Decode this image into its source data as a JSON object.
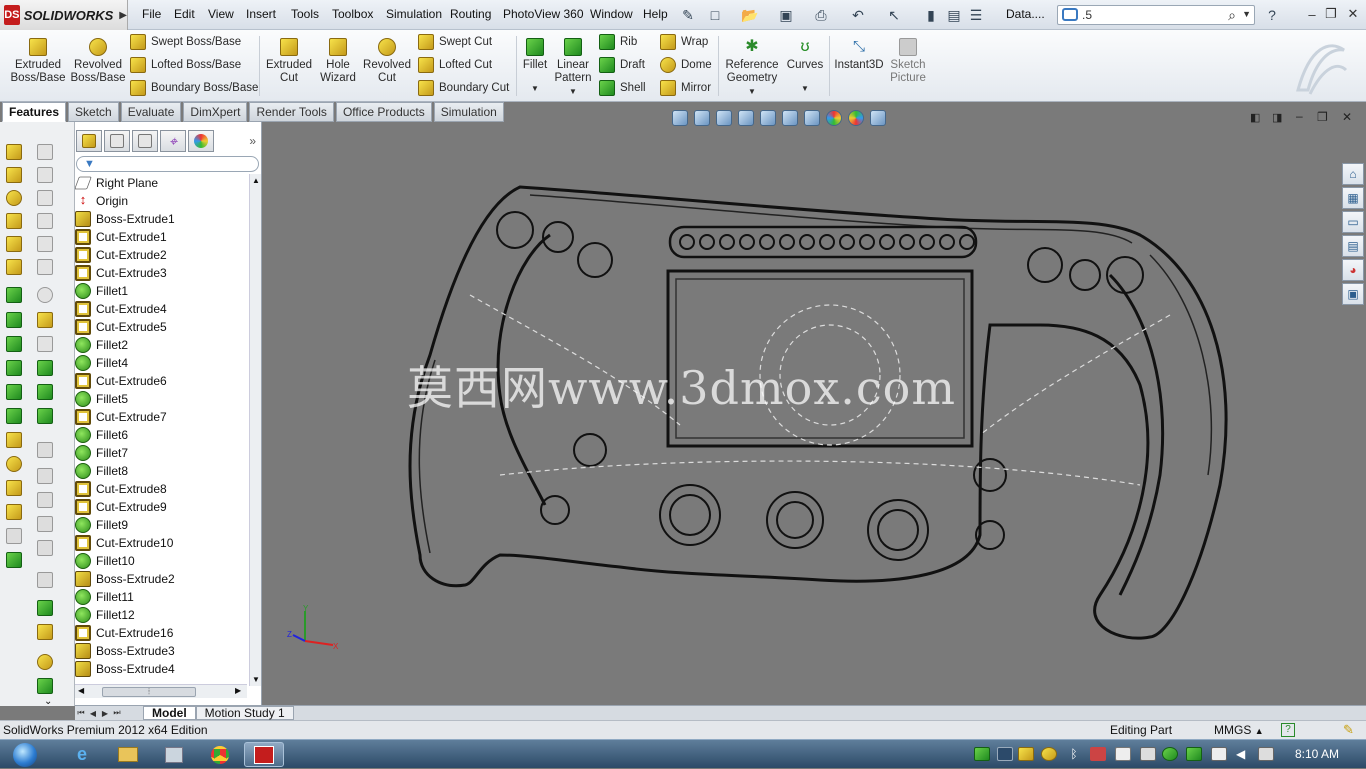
{
  "app": {
    "brand": "SOLIDWORKS",
    "brand_mark": "DS"
  },
  "menu": [
    "File",
    "Edit",
    "View",
    "Insert",
    "Tools",
    "Toolbox",
    "Simulation",
    "Routing",
    "PhotoView 360",
    "Window",
    "Help"
  ],
  "title_doc": "Data....",
  "search": {
    "value": ".5"
  },
  "ribbon": {
    "extruded_boss": "Extruded\nBoss/Base",
    "revolved_boss": "Revolved\nBoss/Base",
    "swept_boss": "Swept Boss/Base",
    "lofted_boss": "Lofted Boss/Base",
    "boundary_boss": "Boundary Boss/Base",
    "extruded_cut": "Extruded\nCut",
    "hole_wizard": "Hole\nWizard",
    "revolved_cut": "Revolved\nCut",
    "swept_cut": "Swept Cut",
    "lofted_cut": "Lofted Cut",
    "boundary_cut": "Boundary Cut",
    "fillet": "Fillet",
    "linear_pattern": "Linear\nPattern",
    "rib": "Rib",
    "draft": "Draft",
    "shell": "Shell",
    "wrap": "Wrap",
    "dome": "Dome",
    "mirror": "Mirror",
    "reference_geometry": "Reference\nGeometry",
    "curves": "Curves",
    "instant3d": "Instant3D",
    "sketch_picture": "Sketch\nPicture"
  },
  "command_tabs": [
    "Features",
    "Sketch",
    "Evaluate",
    "DimXpert",
    "Render Tools",
    "Office Products",
    "Simulation"
  ],
  "feature_tree": [
    {
      "label": "Right Plane",
      "icon": "plane"
    },
    {
      "label": "Origin",
      "icon": "origin"
    },
    {
      "label": "Boss-Extrude1",
      "icon": "ext"
    },
    {
      "label": "Cut-Extrude1",
      "icon": "cut"
    },
    {
      "label": "Cut-Extrude2",
      "icon": "cut"
    },
    {
      "label": "Cut-Extrude3",
      "icon": "cut"
    },
    {
      "label": "Fillet1",
      "icon": "fil"
    },
    {
      "label": "Cut-Extrude4",
      "icon": "cut"
    },
    {
      "label": "Cut-Extrude5",
      "icon": "cut"
    },
    {
      "label": "Fillet2",
      "icon": "fil"
    },
    {
      "label": "Fillet4",
      "icon": "fil"
    },
    {
      "label": "Cut-Extrude6",
      "icon": "cut"
    },
    {
      "label": "Fillet5",
      "icon": "fil"
    },
    {
      "label": "Cut-Extrude7",
      "icon": "cut"
    },
    {
      "label": "Fillet6",
      "icon": "fil"
    },
    {
      "label": "Fillet7",
      "icon": "fil"
    },
    {
      "label": "Fillet8",
      "icon": "fil"
    },
    {
      "label": "Cut-Extrude8",
      "icon": "cut"
    },
    {
      "label": "Cut-Extrude9",
      "icon": "cut"
    },
    {
      "label": "Fillet9",
      "icon": "fil"
    },
    {
      "label": "Cut-Extrude10",
      "icon": "cut"
    },
    {
      "label": "Fillet10",
      "icon": "fil"
    },
    {
      "label": "Boss-Extrude2",
      "icon": "ext"
    },
    {
      "label": "Fillet11",
      "icon": "fil"
    },
    {
      "label": "Fillet12",
      "icon": "fil"
    },
    {
      "label": "Cut-Extrude16",
      "icon": "cut"
    },
    {
      "label": "Boss-Extrude3",
      "icon": "ext"
    },
    {
      "label": "Boss-Extrude4",
      "icon": "ext"
    }
  ],
  "watermark": "莫西网www.3dmox.com",
  "triad": {
    "x": "X",
    "y": "Y",
    "z": "Z"
  },
  "bottom_tabs": [
    "Model",
    "Motion Study 1"
  ],
  "status": {
    "edition": "SolidWorks Premium 2012 x64 Edition",
    "mode": "Editing Part",
    "units": "MMGS"
  },
  "taskbar": {
    "clock": "8:10 AM"
  },
  "colors": {
    "viewport": "#7a7a7a",
    "brand_red": "#c41d1d",
    "taskbar": "#3a5876"
  }
}
